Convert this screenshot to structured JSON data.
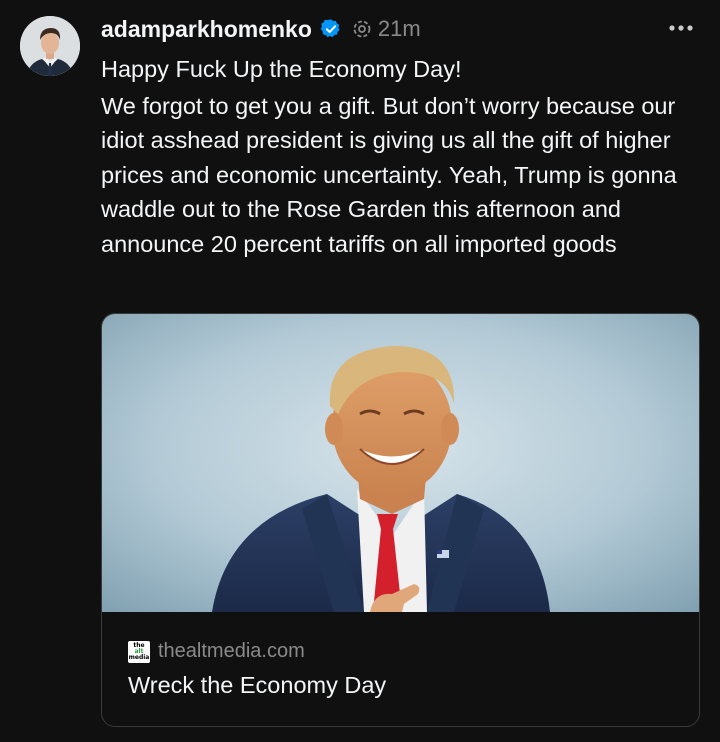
{
  "post": {
    "username": "adamparkhomenko",
    "time": "21m",
    "headline": "Happy Fuck Up the Economy Day!",
    "body": "We forgot to get you a gift. But don’t worry because our idiot asshead president is giving us all the gift of higher prices and economic uncertainty. Yeah, Trump is gonna waddle out to the Rose Garden this afternoon and announce 20 percent tariffs on all imported goods"
  },
  "link_card": {
    "favicon_lines": [
      "the",
      "alt",
      "media"
    ],
    "domain": "thealtmedia.com",
    "title": "Wreck the Economy Day"
  },
  "icons": {
    "verified": "verified-badge-icon",
    "thread": "threads-at-icon",
    "more": "more-options-icon"
  },
  "colors": {
    "background": "#101010",
    "text": "#f3f5f7",
    "secondary_text": "#8a8a8a",
    "verified_blue": "#0095f6",
    "card_border": "#3a3a3a"
  }
}
